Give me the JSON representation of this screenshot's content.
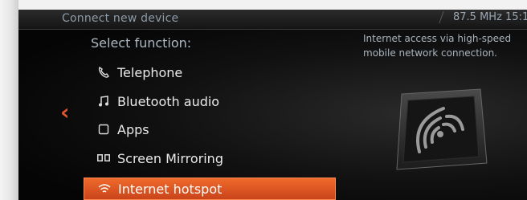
{
  "header": {
    "title": "Connect new device",
    "status": "87.5 MHz  15:1"
  },
  "main": {
    "subtitle": "Select function:",
    "back_glyph": "‹",
    "items": [
      {
        "label": "Telephone",
        "icon": "telephone-icon",
        "selected": false
      },
      {
        "label": "Bluetooth audio",
        "icon": "music-note-icon",
        "selected": false
      },
      {
        "label": "Apps",
        "icon": "apps-icon",
        "selected": false
      },
      {
        "label": "Screen Mirroring",
        "icon": "screen-mirroring-icon",
        "selected": false
      },
      {
        "label": "Internet hotspot",
        "icon": "wifi-icon",
        "selected": true
      }
    ]
  },
  "info": {
    "description": "Internet access via high-speed mobile network connection."
  },
  "colors": {
    "accent": "#e2572a",
    "selection": "#e85a25",
    "text": "#e8e8e8",
    "muted": "#8c9aa7"
  }
}
